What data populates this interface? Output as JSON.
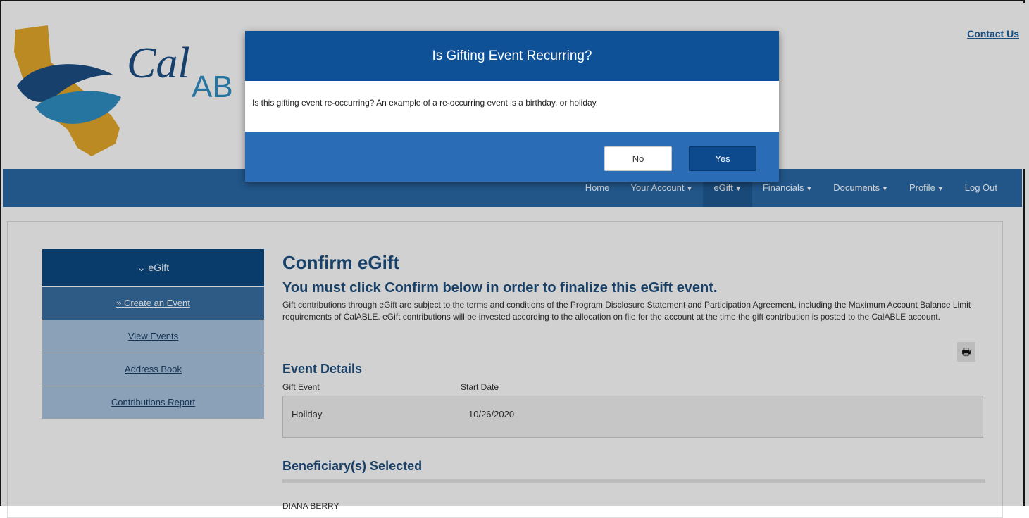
{
  "header": {
    "logo_text": "CalABLE",
    "contact_label": "Contact Us"
  },
  "nav": {
    "items": [
      {
        "label": "Home",
        "dropdown": false
      },
      {
        "label": "Your Account",
        "dropdown": true
      },
      {
        "label": "eGift",
        "dropdown": true,
        "active": true
      },
      {
        "label": "Financials",
        "dropdown": true
      },
      {
        "label": "Documents",
        "dropdown": true
      },
      {
        "label": "Profile",
        "dropdown": true
      },
      {
        "label": "Log Out",
        "dropdown": false
      }
    ]
  },
  "sidebar": {
    "header": "eGift",
    "items": [
      {
        "label": "Create an Event",
        "active": true
      },
      {
        "label": "View Events"
      },
      {
        "label": "Address Book"
      },
      {
        "label": "Contributions Report"
      }
    ]
  },
  "main": {
    "title": "Confirm eGift",
    "subtitle": "You must click Confirm below in order to finalize this eGift event.",
    "body": "Gift contributions through eGift are subject to the terms and conditions of the Program Disclosure Statement and Participation Agreement, including the Maximum Account Balance Limit requirements of CalABLE. eGift contributions will be invested according to the allocation on file for the account at the time the gift contribution is posted to the CalABLE account.",
    "event_details": {
      "heading": "Event Details",
      "col_event": "Gift Event",
      "col_date": "Start Date",
      "event": "Holiday",
      "date": "10/26/2020"
    },
    "beneficiary": {
      "heading": "Beneficiary(s) Selected",
      "name": "DIANA BERRY"
    }
  },
  "modal": {
    "title": "Is Gifting Event Recurring?",
    "message": "Is this gifting event re-occurring? An example of a re-occurring event is a birthday, or holiday.",
    "no_label": "No",
    "yes_label": "Yes"
  },
  "colors": {
    "nav": "#2a6aa8",
    "modal_head": "#0f5197",
    "modal_foot": "#2a6db6",
    "yes_button": "#0d4a8d",
    "heading": "#1f4f7e",
    "sidebar_head": "#0c4a82",
    "sidebar_item": "#a9c5e0"
  }
}
